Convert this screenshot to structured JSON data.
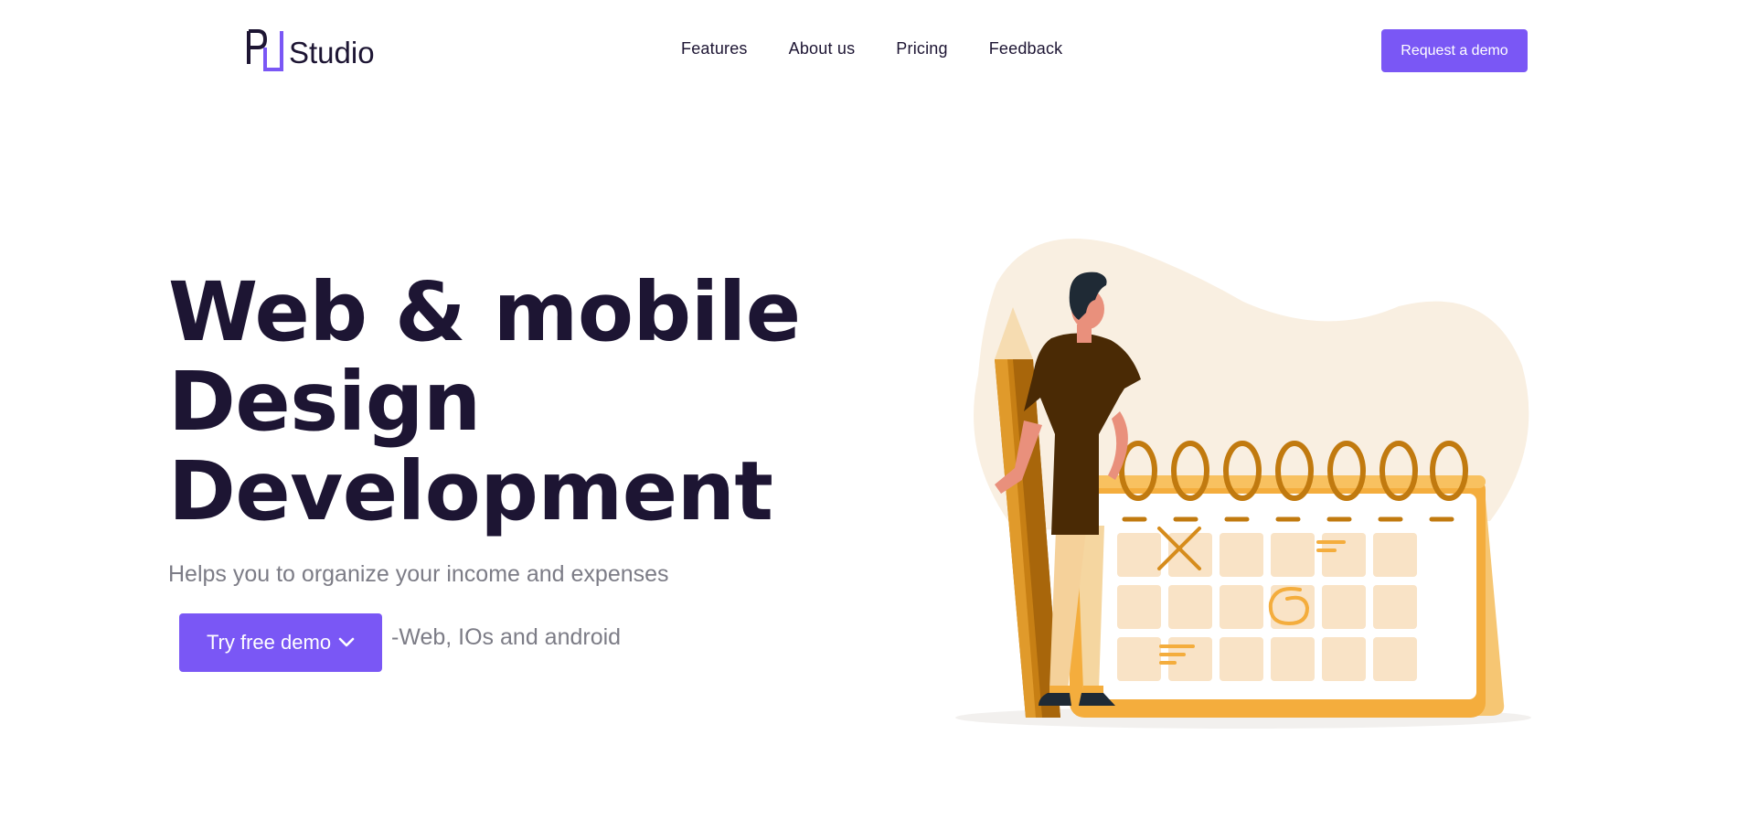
{
  "header": {
    "logo_text": "Studio",
    "logo_mark": "PJ",
    "nav": [
      {
        "label": "Features"
      },
      {
        "label": "About us"
      },
      {
        "label": "Pricing"
      },
      {
        "label": "Feedback"
      }
    ],
    "cta_label": "Request a demo"
  },
  "hero": {
    "title_lines": [
      "Web & mobile",
      "Design",
      "Development"
    ],
    "subtitle": "Helps you to organize your income and expenses",
    "demo_button_label": "Try free demo",
    "demo_button_icon": "chevron-down-icon",
    "platforms_text": "-Web, IOs and android"
  },
  "illustration": {
    "name": "man-with-pencil-and-calendar-illustration"
  },
  "colors": {
    "accent": "#7a57f5",
    "heading": "#1d1533",
    "muted": "#7c7c86",
    "blob": "#f9efe1",
    "calendar_orange": "#f4ad3d",
    "calendar_dark": "#c17a0f"
  }
}
